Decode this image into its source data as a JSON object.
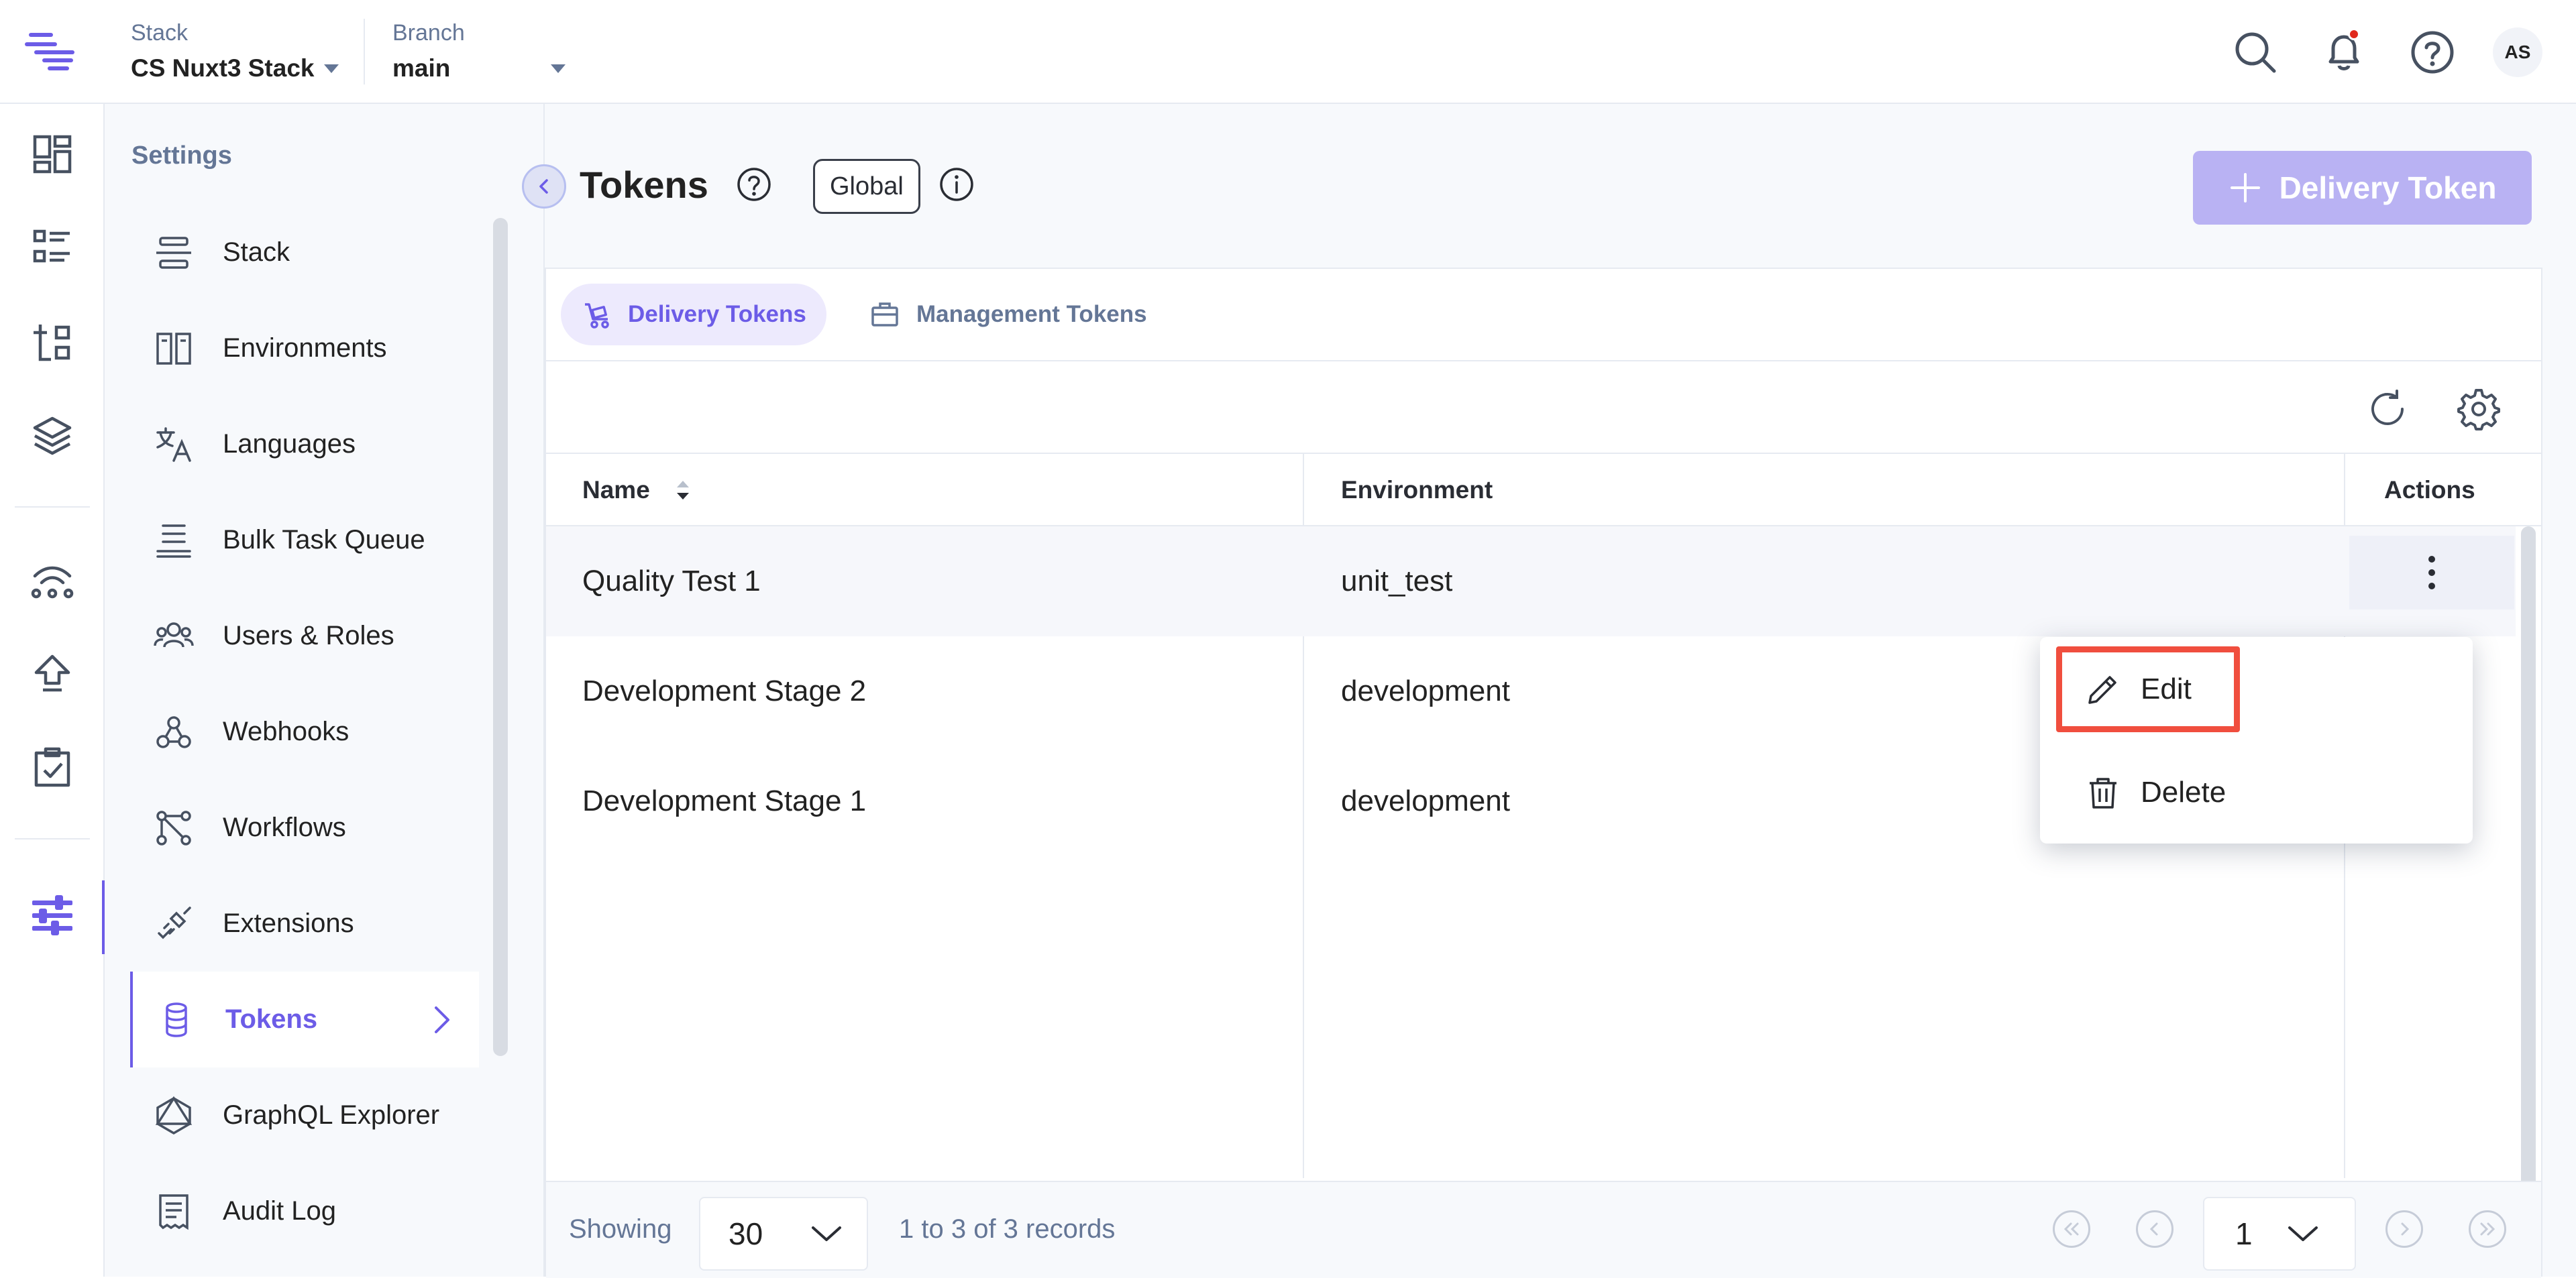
{
  "topbar": {
    "stack_label": "Stack",
    "stack_value": "CS Nuxt3 Stack",
    "branch_label": "Branch",
    "branch_value": "main",
    "avatar_initials": "AS",
    "icons": [
      "search-icon",
      "bell-icon",
      "help-icon"
    ]
  },
  "rail": {
    "icons": [
      "dashboard-icon",
      "entries-icon",
      "content-models-icon",
      "assets-icon",
      "releases-icon",
      "publish-queue-icon",
      "tasks-icon",
      "settings-icon"
    ]
  },
  "settings": {
    "title": "Settings",
    "items": [
      {
        "label": "Stack",
        "icon": "stack-icon"
      },
      {
        "label": "Environments",
        "icon": "environments-icon"
      },
      {
        "label": "Languages",
        "icon": "languages-icon"
      },
      {
        "label": "Bulk Task Queue",
        "icon": "bulk-task-icon"
      },
      {
        "label": "Users & Roles",
        "icon": "users-icon"
      },
      {
        "label": "Webhooks",
        "icon": "webhooks-icon"
      },
      {
        "label": "Workflows",
        "icon": "workflows-icon"
      },
      {
        "label": "Extensions",
        "icon": "extensions-icon"
      },
      {
        "label": "Tokens",
        "icon": "tokens-icon",
        "active": true
      },
      {
        "label": "GraphQL Explorer",
        "icon": "graphql-icon"
      },
      {
        "label": "Audit Log",
        "icon": "audit-log-icon"
      }
    ]
  },
  "main": {
    "title": "Tokens",
    "badge": "Global",
    "primary_button": "Delivery Token",
    "tabs": [
      {
        "label": "Delivery Tokens",
        "active": true
      },
      {
        "label": "Management Tokens",
        "active": false
      }
    ],
    "table": {
      "columns": [
        "Name",
        "Environment",
        "Actions"
      ],
      "rows": [
        {
          "name": "Quality Test 1",
          "environment": "unit_test"
        },
        {
          "name": "Development Stage 2",
          "environment": "development"
        },
        {
          "name": "Development Stage 1",
          "environment": "development"
        }
      ]
    },
    "footer": {
      "showing_label": "Showing",
      "page_size": "30",
      "records": "1 to 3 of 3 records",
      "page": "1"
    },
    "menu": {
      "edit": "Edit",
      "delete": "Delete"
    }
  },
  "colors": {
    "accent": "#6c5ce7",
    "highlight": "#f04e3e"
  }
}
